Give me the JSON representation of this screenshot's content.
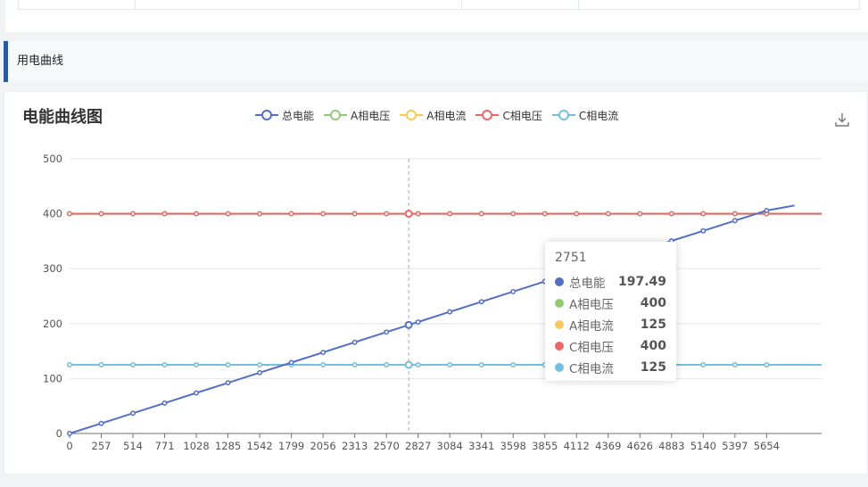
{
  "section": {
    "title": "用电曲线"
  },
  "chart": {
    "title": "电能曲线图",
    "download_icon": "download-icon",
    "legend": [
      {
        "name": "总电能",
        "color": "#5470c6"
      },
      {
        "name": "A相电压",
        "color": "#91cc75"
      },
      {
        "name": "A相电流",
        "color": "#fac858"
      },
      {
        "name": "C相电压",
        "color": "#ee6666"
      },
      {
        "name": "C相电流",
        "color": "#73c0de"
      }
    ],
    "tooltip": {
      "header": "2751",
      "rows": [
        {
          "name": "总电能",
          "value": "197.49",
          "color": "#5470c6"
        },
        {
          "name": "A相电压",
          "value": "400",
          "color": "#91cc75"
        },
        {
          "name": "A相电流",
          "value": "125",
          "color": "#fac858"
        },
        {
          "name": "C相电压",
          "value": "400",
          "color": "#ee6666"
        },
        {
          "name": "C相电流",
          "value": "125",
          "color": "#73c0de"
        }
      ]
    }
  },
  "chart_data": {
    "type": "line",
    "title": "电能曲线图",
    "xlabel": "",
    "ylabel": "",
    "x_ticks": [
      0,
      257,
      514,
      771,
      1028,
      1285,
      1542,
      1799,
      2056,
      2313,
      2570,
      2827,
      3084,
      3341,
      3598,
      3855,
      4112,
      4369,
      4626,
      4883,
      5140,
      5397,
      5654
    ],
    "y_ticks": [
      0,
      100,
      200,
      300,
      400,
      500
    ],
    "xlim": [
      0,
      6100
    ],
    "ylim": [
      0,
      500
    ],
    "grid": true,
    "legend_position": "top",
    "hover_x": 2751,
    "x": [
      0,
      257,
      514,
      771,
      1028,
      1285,
      1542,
      1799,
      2056,
      2313,
      2570,
      2751,
      2827,
      3084,
      3341,
      3598,
      3855,
      4112,
      4369,
      4626,
      4883,
      5140,
      5397,
      5654
    ],
    "series": [
      {
        "name": "总电能",
        "color": "#5470c6",
        "values": [
          0,
          18.4,
          36.9,
          55.3,
          73.8,
          92.2,
          110.7,
          129.1,
          147.6,
          166.0,
          184.5,
          197.49,
          202.9,
          221.4,
          239.8,
          258.2,
          276.7,
          295.1,
          313.6,
          332.0,
          350.5,
          368.9,
          387.4,
          405.8
        ],
        "extend_to": {
          "x": 5880,
          "y": 415
        }
      },
      {
        "name": "A相电压",
        "color": "#91cc75",
        "values": [
          400,
          400,
          400,
          400,
          400,
          400,
          400,
          400,
          400,
          400,
          400,
          400,
          400,
          400,
          400,
          400,
          400,
          400,
          400,
          400,
          400,
          400,
          400,
          400
        ]
      },
      {
        "name": "A相电流",
        "color": "#fac858",
        "values": [
          125,
          125,
          125,
          125,
          125,
          125,
          125,
          125,
          125,
          125,
          125,
          125,
          125,
          125,
          125,
          125,
          125,
          125,
          125,
          125,
          125,
          125,
          125,
          125
        ]
      },
      {
        "name": "C相电压",
        "color": "#ee6666",
        "values": [
          400,
          400,
          400,
          400,
          400,
          400,
          400,
          400,
          400,
          400,
          400,
          400,
          400,
          400,
          400,
          400,
          400,
          400,
          400,
          400,
          400,
          400,
          400,
          400
        ]
      },
      {
        "name": "C相电流",
        "color": "#73c0de",
        "values": [
          125,
          125,
          125,
          125,
          125,
          125,
          125,
          125,
          125,
          125,
          125,
          125,
          125,
          125,
          125,
          125,
          125,
          125,
          125,
          125,
          125,
          125,
          125,
          125
        ]
      }
    ]
  }
}
